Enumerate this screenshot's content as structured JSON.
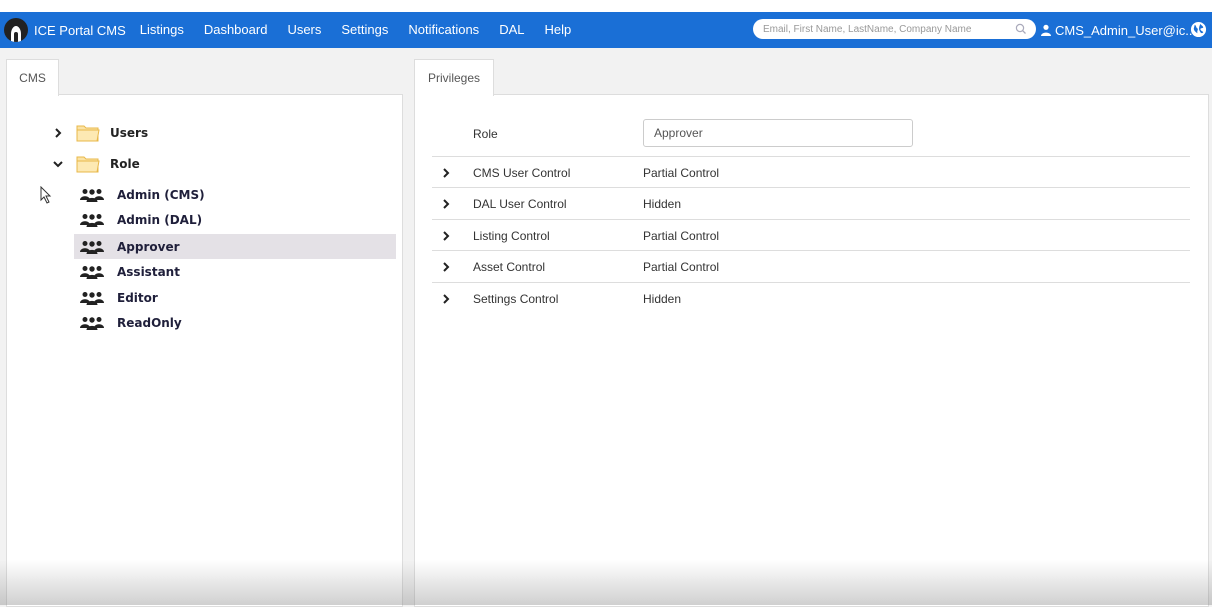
{
  "app": {
    "brand": "ICE Portal CMS",
    "nav": [
      "Listings",
      "Dashboard",
      "Users",
      "Settings",
      "Notifications",
      "DAL",
      "Help"
    ],
    "active_nav": "Users",
    "search_placeholder": "Email, First Name, LastName, Company Name",
    "user_label": "CMS_Admin_User@ic...",
    "accent_color": "#1a6fd6"
  },
  "left_panel": {
    "tab": "CMS",
    "tree": {
      "users": "Users",
      "role": "Role",
      "roles": [
        "Admin (CMS)",
        "Admin (DAL)",
        "Approver",
        "Assistant",
        "Editor",
        "ReadOnly"
      ],
      "selected": "Approver"
    }
  },
  "right_panel": {
    "tab": "Privileges",
    "role_label": "Role",
    "role_value": "Approver",
    "privileges": [
      {
        "name": "CMS User Control",
        "value": "Partial Control"
      },
      {
        "name": "DAL User Control",
        "value": "Hidden"
      },
      {
        "name": "Listing Control",
        "value": "Partial Control"
      },
      {
        "name": "Asset Control",
        "value": "Partial Control"
      },
      {
        "name": "Settings Control",
        "value": "Hidden"
      }
    ]
  }
}
